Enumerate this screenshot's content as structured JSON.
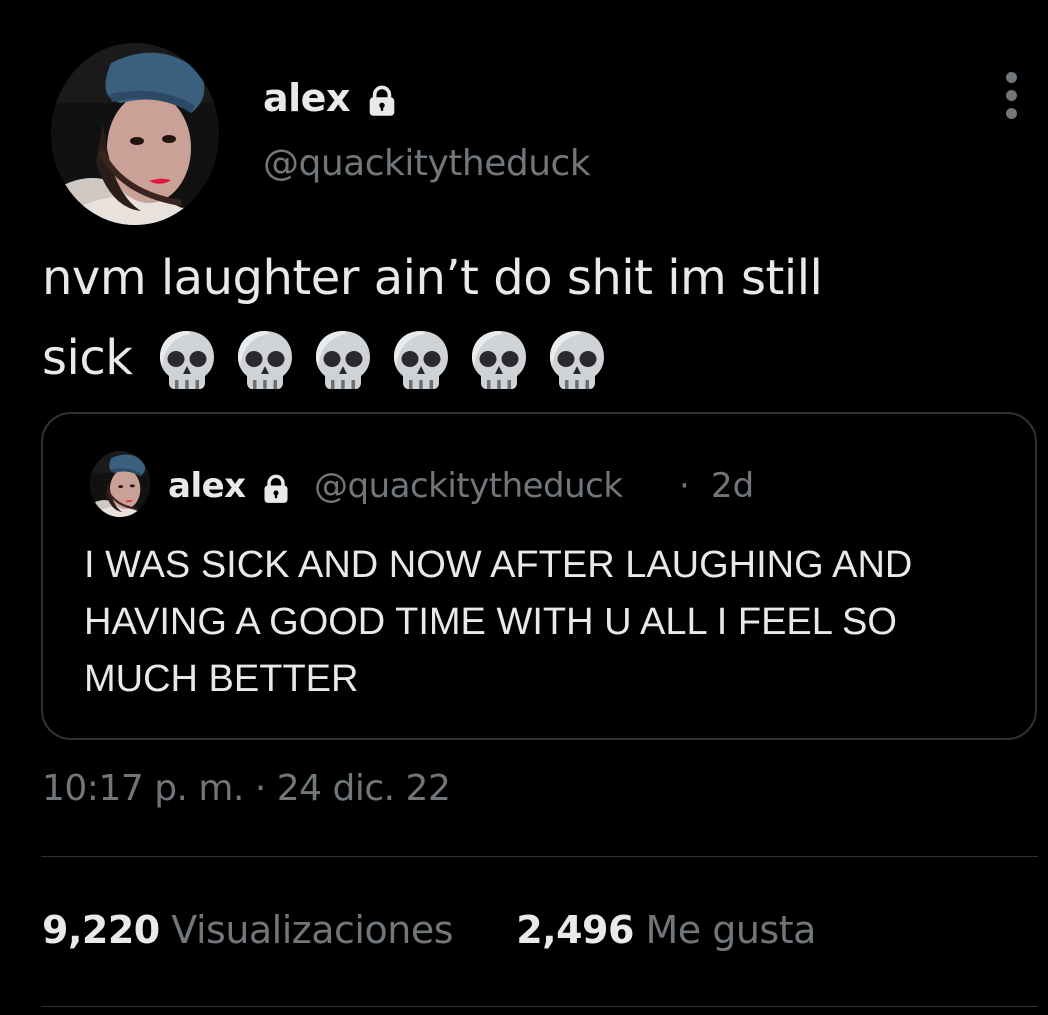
{
  "author": {
    "display_name": "alex",
    "handle": "@quackitytheduck",
    "protected_icon": "lock-icon"
  },
  "more_icon": "more-vertical-icon",
  "tweet": {
    "text_line1": "nvm laughter ain’t do shit im still",
    "text_line2": "sick",
    "emoji": [
      "skull",
      "skull",
      "skull",
      "skull",
      "skull",
      "skull"
    ],
    "timestamp": "10:17 p. m. · 24 dic. 22"
  },
  "quoted_tweet": {
    "display_name": "alex",
    "handle": "@quackitytheduck",
    "separator": "·",
    "time": "2d",
    "text_lines": [
      "I WAS SICK AND NOW AFTER LAUGHING AND",
      "HAVING A GOOD TIME WITH U ALL I FEEL SO",
      "MUCH BETTER"
    ]
  },
  "stats": {
    "views_count": "9,220",
    "views_label": "Visualizaciones",
    "likes_count": "2,496",
    "likes_label": "Me gusta"
  },
  "colors": {
    "background": "#000000",
    "primary_text": "#e7e9ea",
    "secondary_text": "#71767b",
    "border": "#2f3336"
  }
}
